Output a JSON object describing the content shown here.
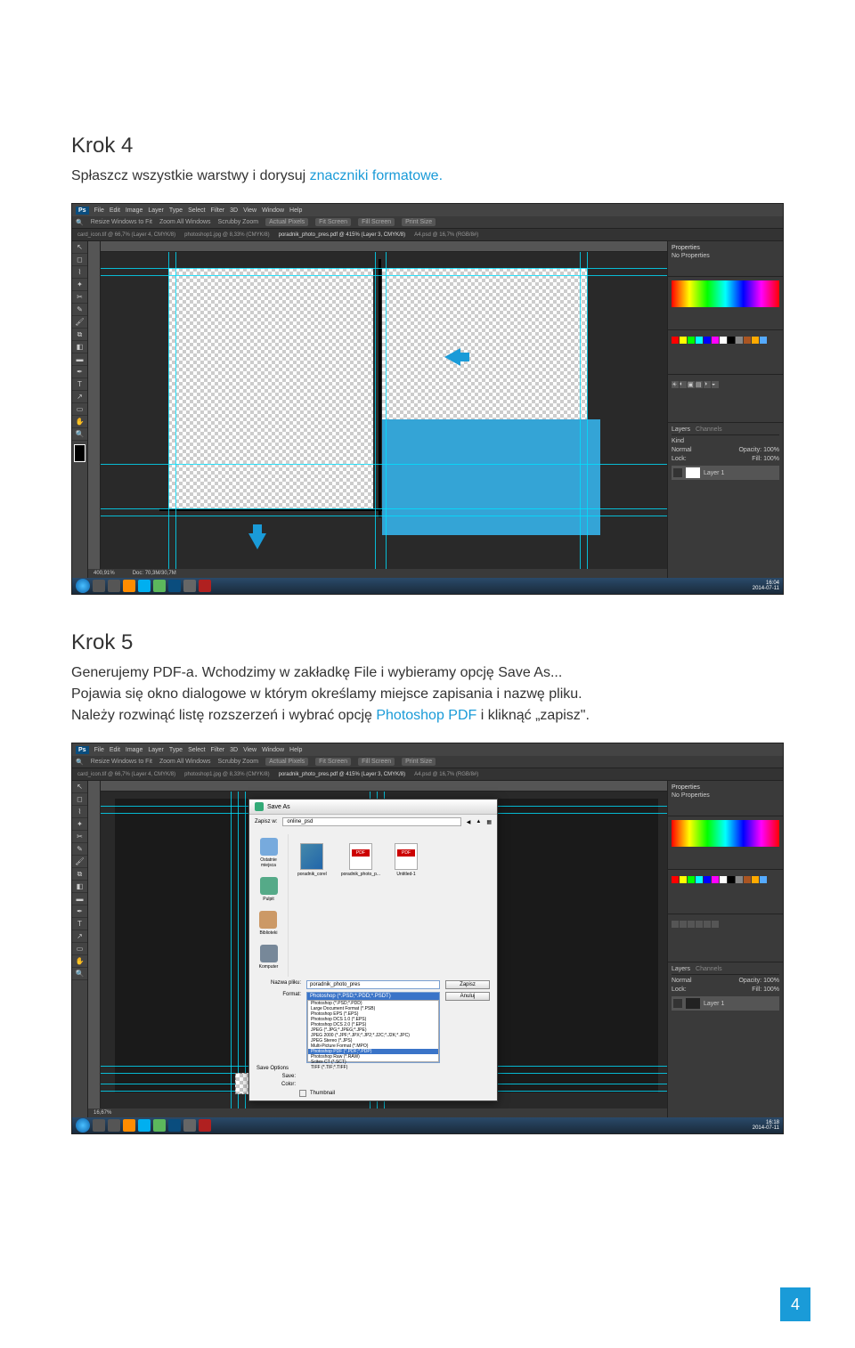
{
  "step4": {
    "title": "Krok 4",
    "text_a": "Spłaszcz wszystkie warstwy i dorysuj ",
    "text_link": "znaczniki formatowe."
  },
  "step5": {
    "title": "Krok 5",
    "text_a": "Generujemy PDF-a. Wchodzimy w zakładkę File i wybieramy opcję Save As...",
    "text_b": "Pojawia się okno dialogowe w którym określamy miejsce zapisania i nazwę pliku.",
    "text_c_a": "Należy rozwinąć listę rozszerzeń i wybrać opcję ",
    "text_c_link": "Photoshop PDF",
    "text_c_b": " i kliknąć „zapisz\"."
  },
  "ps": {
    "menu": [
      "File",
      "Edit",
      "Image",
      "Layer",
      "Type",
      "Select",
      "Filter",
      "3D",
      "View",
      "Window",
      "Help"
    ],
    "tool_buttons": [
      "Actual Pixels",
      "Fit Screen",
      "Fill Screen",
      "Print Size"
    ],
    "resize_label": "Resize Windows to Fit",
    "zoom_all": "Zoom All Windows",
    "scrubby": "Scrubby Zoom",
    "tabs": [
      "card_icon.tif @ 66,7% (Layer 4, CMYK/8)",
      "photoshop1.jpg @ 8,33% (CMYK/8)",
      "poradnik_photo_pres.pdf @ 415% (Layer 3, CMYK/8)",
      "A4.psd @ 16,7% (RGB/8#)"
    ],
    "zoom": "400,91%",
    "doc_info": "Doc: 70,3M/30,7M",
    "properties": "Properties",
    "no_properties": "No Properties",
    "layers_tab": "Layers",
    "channels_tab": "Channels",
    "kind": "Kind",
    "normal": "Normal",
    "opacity_lbl": "Opacity:",
    "opacity_val": "100%",
    "lock_lbl": "Lock:",
    "fill_lbl": "Fill:",
    "fill_val": "100%",
    "layer1": "Layer 1"
  },
  "taskbar": {
    "time1": "16:04",
    "date1": "2014-07-11",
    "time2": "16:18",
    "date2": "2014-07-11"
  },
  "save_dialog": {
    "title": "Save As",
    "zapis_w": "Zapisz w:",
    "folder": "online_psd",
    "locations": [
      "Ostatnie miejsca",
      "Pulpit",
      "Biblioteki",
      "Komputer"
    ],
    "files": [
      "poradnik_corel",
      "poradnik_photo_p...",
      "Untitled-1"
    ],
    "nazwa_pliku_lbl": "Nazwa pliku:",
    "nazwa_pliku_val": "poradnik_photo_pres",
    "format_lbl": "Format:",
    "format_sel": "Photoshop (*.PSD;*.PDD;*.PSDT)",
    "formats": [
      "Photoshop (*.PSD;*.PDD)",
      "Large Document Format (*.PSB)",
      "Photoshop EPS (*.EPS)",
      "Photoshop DCS 1.0 (*.EPS)",
      "Photoshop DCS 2.0 (*.EPS)",
      "JPEG (*.JPG;*.JPEG;*.JPE)",
      "JPEG 2000 (*.JPF;*.JPX;*.JP2;*.J2C;*.J2K;*.JPC)",
      "JPEG Stereo (*.JPS)",
      "Multi-Picture Format (*.MPO)",
      "Photoshop PDF (*.PDF;*.PDP)",
      "Photoshop Raw (*.RAW)",
      "Scitex CT (*.SCT)",
      "TIFF (*.TIF;*.TIFF)"
    ],
    "format_hl": "Photoshop PDF (*.PDF;*.PDP)",
    "save_options_lbl": "Save Options",
    "save_lbl": "Save:",
    "color_lbl": "Color:",
    "thumbnail": "Thumbnail",
    "zapisz_btn": "Zapisz",
    "anuluj_btn": "Anuluj"
  },
  "page_number": "4"
}
